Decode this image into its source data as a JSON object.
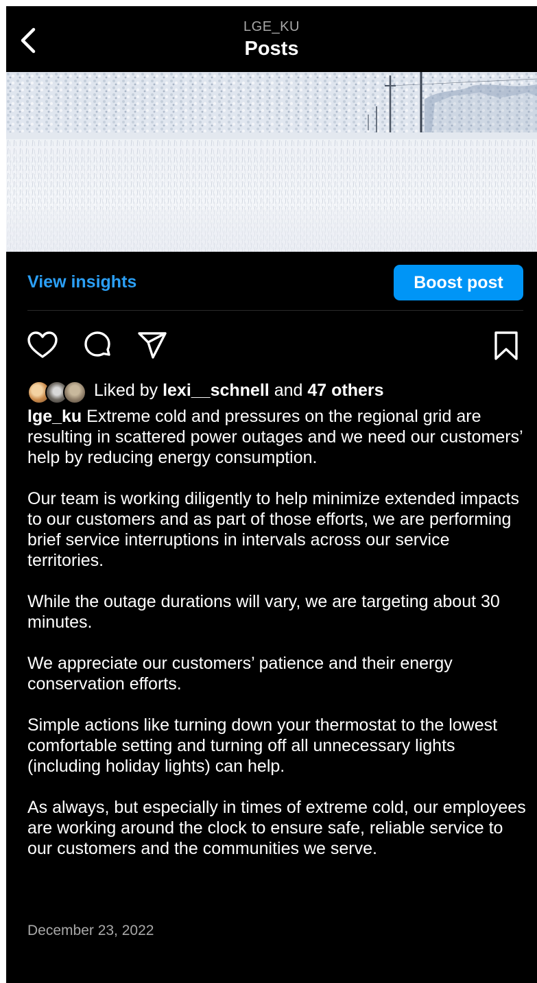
{
  "header": {
    "username": "LGE_KU",
    "title": "Posts"
  },
  "insights": {
    "view_label": "View insights",
    "boost_label": "Boost post"
  },
  "likes": {
    "prefix": "Liked by",
    "user": "lexi__schnell",
    "conj": "and",
    "others": "47 others"
  },
  "caption": {
    "author": "lge_ku",
    "p1": "Extreme cold and pressures on the regional grid are resulting in scattered power outages and we need our customers’ help by reducing energy consumption.",
    "p2": "Our team is working diligently to help minimize extended impacts to our customers and as part of those efforts, we are performing brief service interruptions in intervals across our service territories.",
    "p3": "While the outage durations will vary, we are targeting about 30 minutes.",
    "p4": "We appreciate our customers’ patience and their energy conservation efforts.",
    "p5": "Simple actions like turning down your thermostat to the lowest comfortable setting and turning off all unnecessary lights (including holiday lights) can help.",
    "p6": "As always, but especially in times of extreme cold, our employees are working around the clock to ensure safe, reliable service to our customers and the communities we serve."
  },
  "date": "December 23, 2022",
  "icons": {
    "back": "chevron-left-icon",
    "like": "heart-icon",
    "comment": "comment-bubble-icon",
    "share": "paper-plane-icon",
    "save": "bookmark-icon"
  },
  "colors": {
    "background": "#000000",
    "link_blue": "#2b9ff5",
    "boost_button": "#0095f6",
    "secondary_text": "#a8a8a8"
  }
}
